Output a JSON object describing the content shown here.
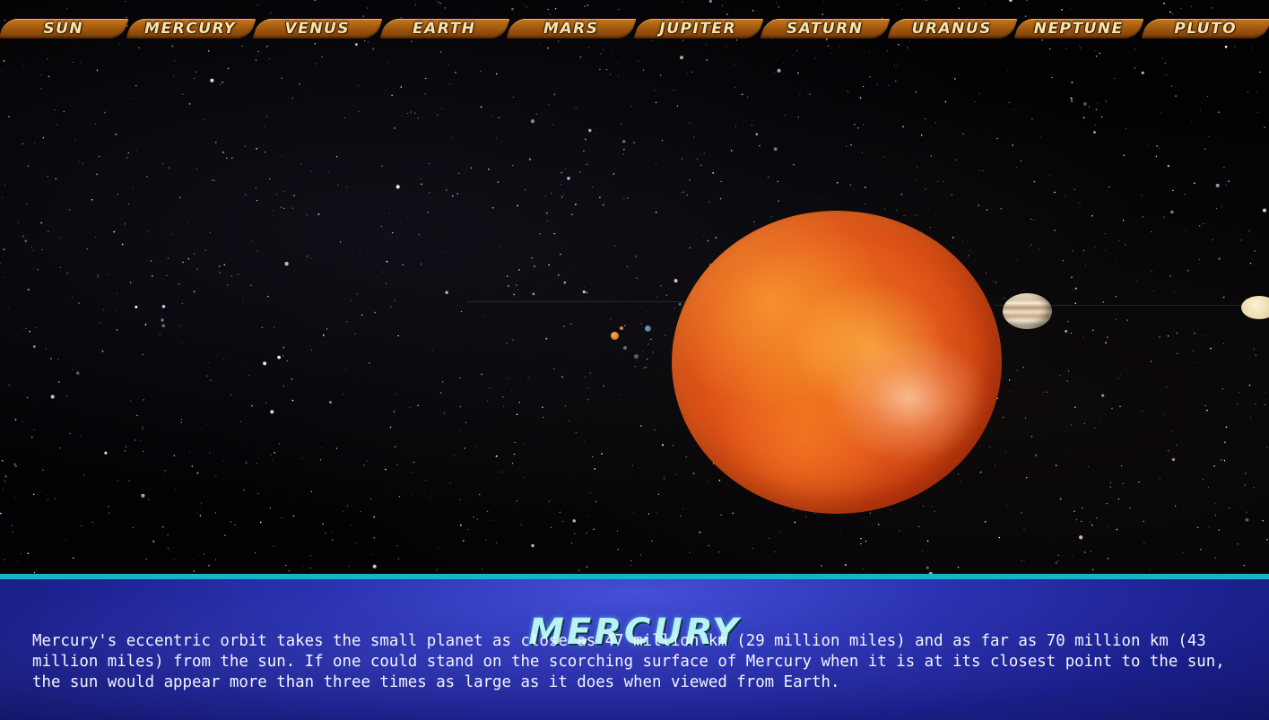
{
  "nav": {
    "items": [
      {
        "label": "Sun"
      },
      {
        "label": "Mercury"
      },
      {
        "label": "Venus"
      },
      {
        "label": "Earth"
      },
      {
        "label": "Mars"
      },
      {
        "label": "Jupiter"
      },
      {
        "label": "Saturn"
      },
      {
        "label": "Uranus"
      },
      {
        "label": "Neptune"
      },
      {
        "label": "Pluto"
      }
    ]
  },
  "info": {
    "title": "MERCURY",
    "description": "Mercury's eccentric orbit takes the small planet as close as 47 million km (29 million miles) and as far as 70 million km (43 million miles) from the sun. If one could stand on the scorching surface of Mercury when it is at its closest point to the sun, the sun would appear more than three times as large as it does when viewed from Earth."
  },
  "colors": {
    "nav_tab": "#a45a10",
    "nav_text": "#f4e3b0",
    "panel_bg": "#2a32b0",
    "panel_border": "#18b4c4",
    "title_text": "#b8f2f5",
    "body_text": "#f4f4ff",
    "planet": "#e2581a"
  }
}
